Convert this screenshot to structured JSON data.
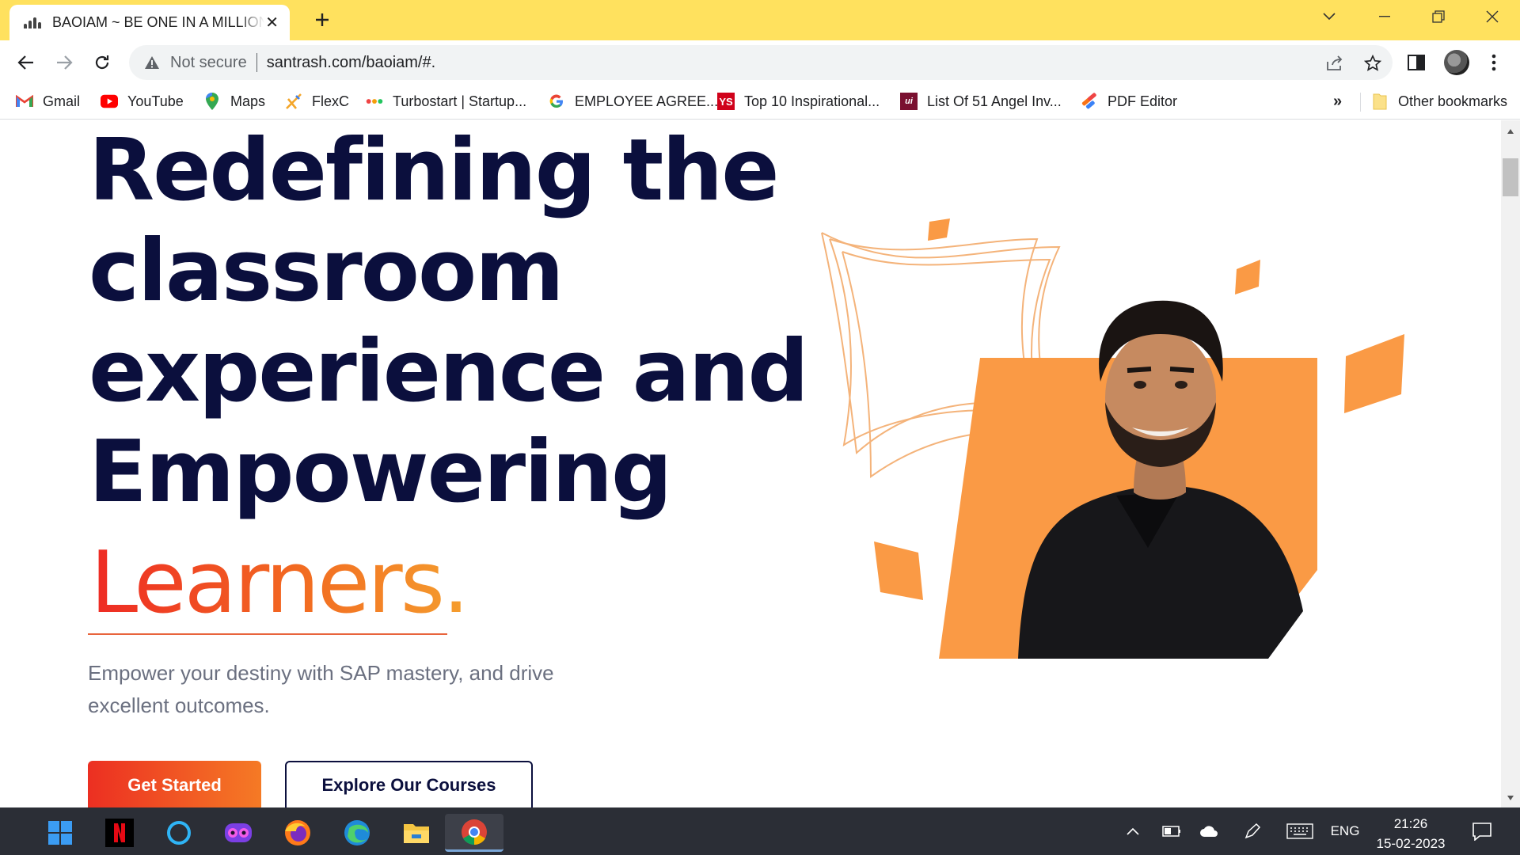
{
  "tab": {
    "title": "BAOIAM ~ BE ONE IN A MILLION",
    "close": "✕",
    "new_tab": "+"
  },
  "window_controls": {
    "tab_search": "⌄",
    "minimize": "—",
    "restore": "❐",
    "close": "✕"
  },
  "toolbar": {
    "security_label": "Not secure",
    "url": "santrash.com/baoiam/#."
  },
  "bookmarks": {
    "items": [
      {
        "label": "Gmail",
        "icon": "gmail-icon"
      },
      {
        "label": "YouTube",
        "icon": "youtube-icon"
      },
      {
        "label": "Maps",
        "icon": "maps-icon"
      },
      {
        "label": "FlexC",
        "icon": "flexc-icon"
      },
      {
        "label": "Turbostart | Startup...",
        "icon": "turbostart-icon"
      },
      {
        "label": "EMPLOYEE AGREE...",
        "icon": "google-icon"
      },
      {
        "label": "Top 10 Inspirational...",
        "icon": "ys-icon",
        "badge": "YS"
      },
      {
        "label": "List Of 51 Angel Inv...",
        "icon": "angel-icon",
        "badge": "ui"
      },
      {
        "label": "PDF Editor",
        "icon": "pdf-editor-icon"
      }
    ],
    "more": "»",
    "other": "Other bookmarks"
  },
  "hero": {
    "line1": "Redefining the",
    "line2": "classroom",
    "line3": "experience and",
    "line4": "Empowering",
    "highlight": "Learners.",
    "subtitle": "Empower your destiny with SAP mastery, and drive excellent outcomes.",
    "primary_button": "Get Started",
    "secondary_button": "Explore Our Courses"
  },
  "colors": {
    "tab_strip": "#ffe15e",
    "headline": "#0b0f3d",
    "accent_orange": "#fa9a45",
    "accent_red": "#ee2a24"
  },
  "taskbar": {
    "apps": [
      "windows-start-icon",
      "netflix-icon",
      "cortana-icon",
      "mask-app-icon",
      "firefox-icon",
      "edge-icon",
      "file-explorer-icon",
      "chrome-icon"
    ],
    "language": "ENG",
    "time": "21:26",
    "date": "15-02-2023"
  }
}
